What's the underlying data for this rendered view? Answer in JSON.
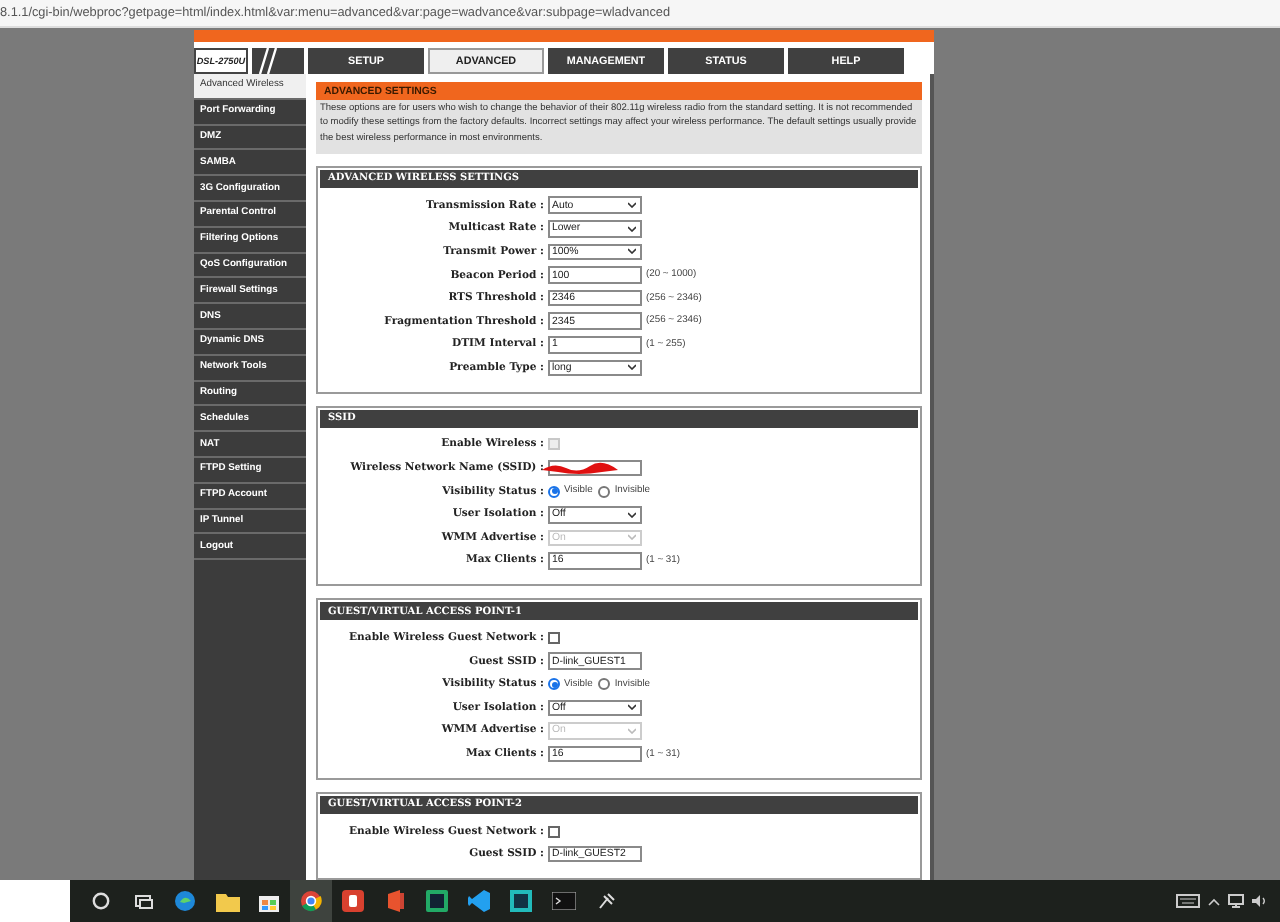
{
  "browser": {
    "url": "8.1.1/cgi-bin/webproc?getpage=html/index.html&var:menu=advanced&var:page=wadvance&var:subpage=wladvanced"
  },
  "model": "DSL-2750U",
  "tabs": [
    {
      "label": "SETUP",
      "selected": false
    },
    {
      "label": "ADVANCED",
      "selected": true
    },
    {
      "label": "MANAGEMENT",
      "selected": false
    },
    {
      "label": "STATUS",
      "selected": false
    },
    {
      "label": "HELP",
      "selected": false
    }
  ],
  "sidebar": [
    {
      "label": "Advanced Wireless",
      "selected": true
    },
    {
      "label": "Port Forwarding",
      "selected": false
    },
    {
      "label": "DMZ",
      "selected": false
    },
    {
      "label": "SAMBA",
      "selected": false
    },
    {
      "label": "3G Configuration",
      "selected": false
    },
    {
      "label": "Parental Control",
      "selected": false
    },
    {
      "label": "Filtering Options",
      "selected": false
    },
    {
      "label": "QoS Configuration",
      "selected": false
    },
    {
      "label": "Firewall Settings",
      "selected": false
    },
    {
      "label": "DNS",
      "selected": false
    },
    {
      "label": "Dynamic DNS",
      "selected": false
    },
    {
      "label": "Network Tools",
      "selected": false
    },
    {
      "label": "Routing",
      "selected": false
    },
    {
      "label": "Schedules",
      "selected": false
    },
    {
      "label": "NAT",
      "selected": false
    },
    {
      "label": "FTPD Setting",
      "selected": false
    },
    {
      "label": "FTPD Account",
      "selected": false
    },
    {
      "label": "IP Tunnel",
      "selected": false
    },
    {
      "label": "Logout",
      "selected": false
    }
  ],
  "intro": {
    "title": "ADVANCED SETTINGS",
    "text": "These options are for users who wish to change the behavior of their 802.11g wireless radio from the standard setting. It is not recommended to modify these settings from the factory defaults. Incorrect settings may affect your wireless performance. The default settings usually provide the best wireless performance in most environments."
  },
  "sections": [
    {
      "title": "ADVANCED WIRELESS SETTINGS",
      "rows": [
        {
          "kind": "select",
          "label": "Transmission Rate :",
          "value": "Auto",
          "disabled": false
        },
        {
          "kind": "select",
          "label": "Multicast Rate :",
          "value": "Lower",
          "disabled": false
        },
        {
          "kind": "select",
          "label": "Transmit Power :",
          "value": "100%",
          "disabled": false
        },
        {
          "kind": "text",
          "label": "Beacon Period :",
          "value": "100",
          "hint": "(20 ~ 1000)"
        },
        {
          "kind": "text",
          "label": "RTS Threshold :",
          "value": "2346",
          "hint": "(256 ~ 2346)"
        },
        {
          "kind": "text",
          "label": "Fragmentation Threshold :",
          "value": "2345",
          "hint": "(256 ~ 2346)"
        },
        {
          "kind": "text",
          "label": "DTIM Interval :",
          "value": "1",
          "hint": "(1 ~ 255)"
        },
        {
          "kind": "select",
          "label": "Preamble Type :",
          "value": "long",
          "disabled": false
        }
      ]
    },
    {
      "title": "SSID",
      "rows": [
        {
          "kind": "checkbox",
          "label": "Enable Wireless :",
          "checked": false,
          "disabled": true
        },
        {
          "kind": "redacted",
          "label": "Wireless Network Name (SSID) :"
        },
        {
          "kind": "radio",
          "label": "Visibility Status :",
          "options": [
            {
              "label": "Visible",
              "selected": true
            },
            {
              "label": "Invisible",
              "selected": false
            }
          ]
        },
        {
          "kind": "select",
          "label": "User Isolation :",
          "value": "Off",
          "disabled": false
        },
        {
          "kind": "select",
          "label": "WMM Advertise :",
          "value": "On",
          "disabled": true
        },
        {
          "kind": "text",
          "label": "Max Clients :",
          "value": "16",
          "hint": "(1 ~ 31)"
        }
      ]
    },
    {
      "title": "GUEST/VIRTUAL ACCESS POINT-1",
      "rows": [
        {
          "kind": "checkbox",
          "label": "Enable Wireless Guest Network :",
          "checked": false,
          "disabled": false
        },
        {
          "kind": "text",
          "label": "Guest SSID :",
          "value": "D-link_GUEST1"
        },
        {
          "kind": "radio",
          "label": "Visibility Status :",
          "options": [
            {
              "label": "Visible",
              "selected": true
            },
            {
              "label": "Invisible",
              "selected": false
            }
          ]
        },
        {
          "kind": "select",
          "label": "User Isolation :",
          "value": "Off",
          "disabled": false
        },
        {
          "kind": "select",
          "label": "WMM Advertise :",
          "value": "On",
          "disabled": true
        },
        {
          "kind": "text",
          "label": "Max Clients :",
          "value": "16",
          "hint": "(1 ~ 31)"
        }
      ]
    },
    {
      "title": "GUEST/VIRTUAL ACCESS POINT-2",
      "rows": [
        {
          "kind": "checkbox",
          "label": "Enable Wireless Guest Network :",
          "checked": false,
          "disabled": false
        },
        {
          "kind": "text",
          "label": "Guest SSID :",
          "value": "D-link_GUEST2"
        }
      ]
    }
  ],
  "taskbar": {
    "apps": [
      {
        "selected": false
      },
      {
        "selected": false
      },
      {
        "selected": false
      },
      {
        "selected": false
      },
      {
        "selected": false
      },
      {
        "selected": true
      },
      {
        "selected": false
      },
      {
        "selected": false
      },
      {
        "selected": false
      },
      {
        "selected": false
      },
      {
        "selected": false
      },
      {
        "selected": false
      },
      {
        "selected": false
      }
    ]
  }
}
